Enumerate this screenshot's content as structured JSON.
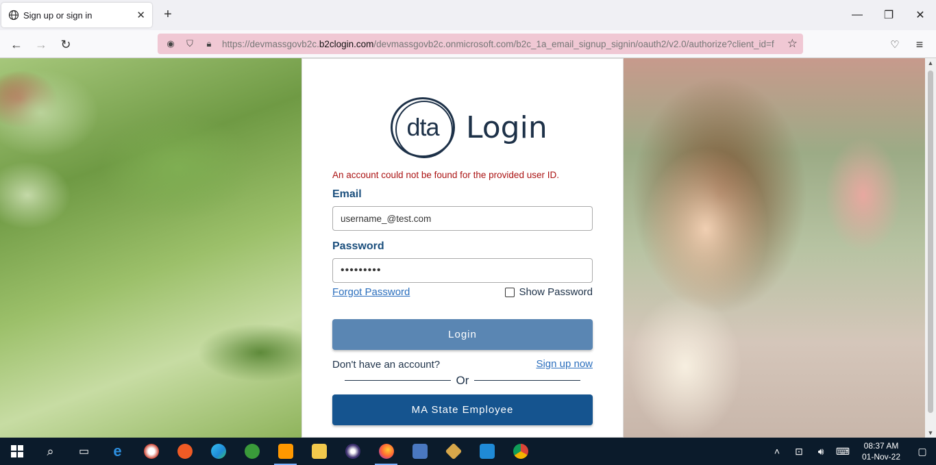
{
  "browser": {
    "tab_title": "Sign up or sign in",
    "url_prefix": "https://devmassgovb2c.",
    "url_host": "b2clogin.com",
    "url_rest": "/devmassgovb2c.onmicrosoft.com/b2c_1a_email_signup_signin/oauth2/v2.0/authorize?client_id=f"
  },
  "login": {
    "logo_text": "dta",
    "heading": "Login",
    "error_message": "An account could not be found for the provided user ID.",
    "email_label": "Email",
    "email_value": "username_@test.com",
    "password_label": "Password",
    "password_value": "•••••••••",
    "forgot_password": "Forgot Password",
    "show_password": "Show Password",
    "login_button": "Login",
    "no_account_text": "Don't have an account?",
    "signup_link": "Sign up now",
    "or_text": "Or",
    "state_employee_button": "MA State Employee"
  },
  "taskbar": {
    "time": "08:37 AM",
    "date": "01-Nov-22",
    "apps": [
      "internet-explorer",
      "snip-tool",
      "postman",
      "edge",
      "app-green",
      "sublime-text",
      "file-explorer",
      "eclipse",
      "firefox",
      "network-app",
      "git-app",
      "vscode",
      "chrome"
    ]
  },
  "colors": {
    "brand_navy": "#1d3148",
    "label_blue": "#1b4f7d",
    "error_red": "#aa1111",
    "login_button": "#5a86b3",
    "state_button": "#15548f"
  }
}
